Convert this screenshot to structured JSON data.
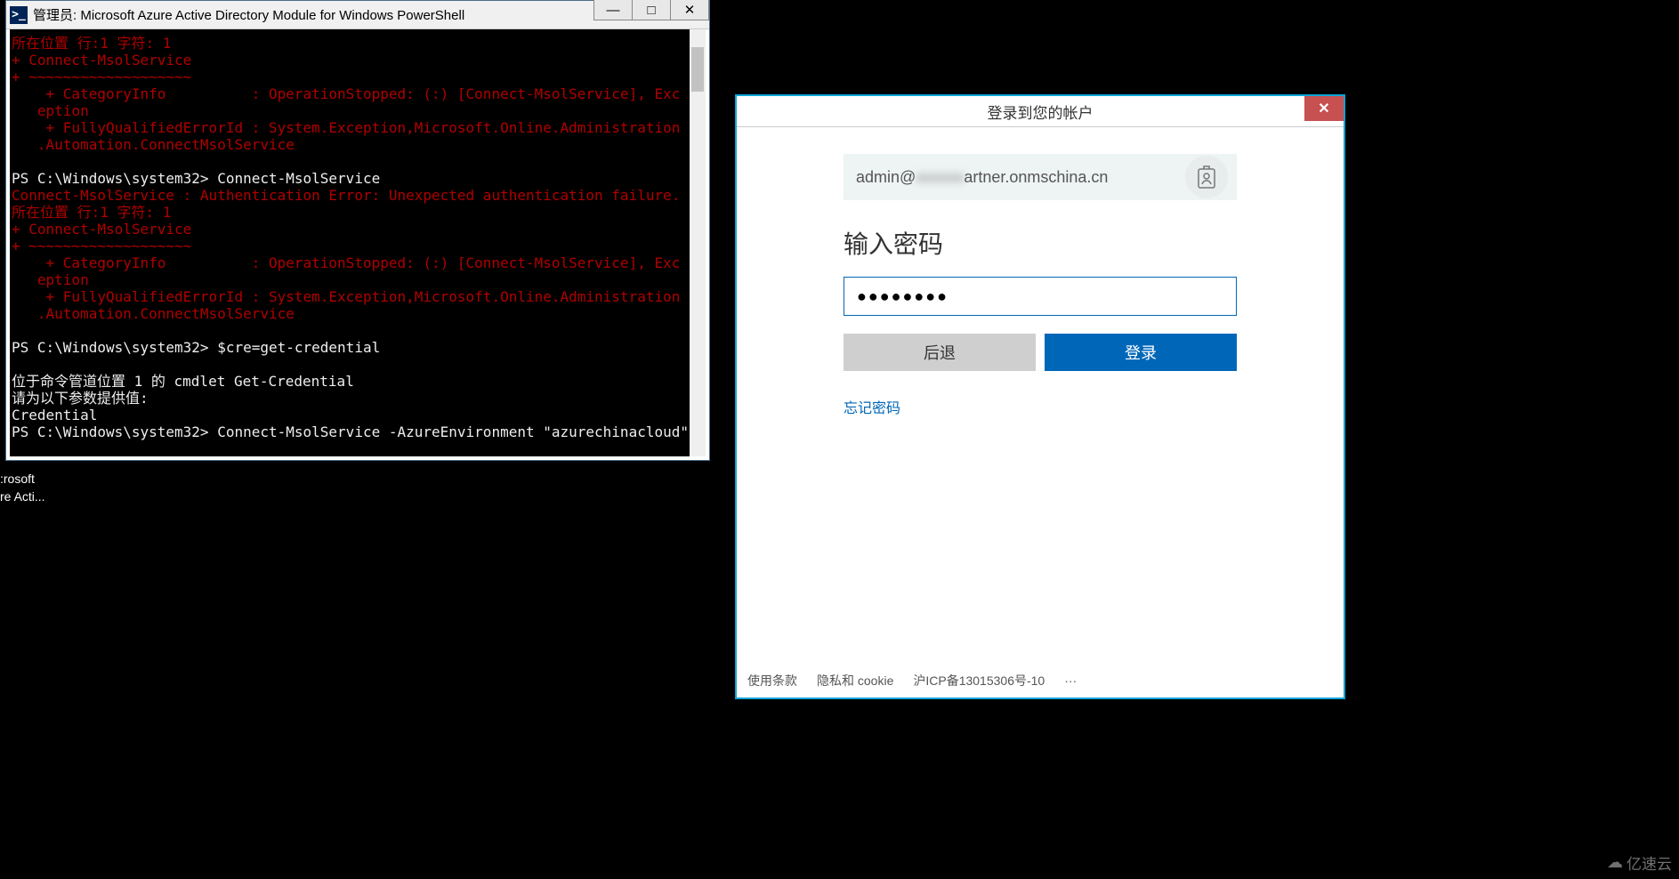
{
  "powershell": {
    "title": "管理员: Microsoft Azure Active Directory Module for Windows PowerShell",
    "icon_glyph": ">_",
    "lines": [
      {
        "cls": "red",
        "text": "所在位置 行:1 字符: 1"
      },
      {
        "cls": "red",
        "text": "+ Connect-MsolService"
      },
      {
        "cls": "red",
        "text": "+ ~~~~~~~~~~~~~~~~~~~"
      },
      {
        "cls": "red",
        "text": "    + CategoryInfo          : OperationStopped: (:) [Connect-MsolService], Exc"
      },
      {
        "cls": "red",
        "text": "   eption"
      },
      {
        "cls": "red",
        "text": "    + FullyQualifiedErrorId : System.Exception,Microsoft.Online.Administration"
      },
      {
        "cls": "red",
        "text": "   .Automation.ConnectMsolService"
      },
      {
        "cls": "white",
        "text": ""
      },
      {
        "cls": "white",
        "text": "PS C:\\Windows\\system32> Connect-MsolService"
      },
      {
        "cls": "red",
        "text": "Connect-MsolService : Authentication Error: Unexpected authentication failure."
      },
      {
        "cls": "red",
        "text": "所在位置 行:1 字符: 1"
      },
      {
        "cls": "red",
        "text": "+ Connect-MsolService"
      },
      {
        "cls": "red",
        "text": "+ ~~~~~~~~~~~~~~~~~~~"
      },
      {
        "cls": "red",
        "text": "    + CategoryInfo          : OperationStopped: (:) [Connect-MsolService], Exc"
      },
      {
        "cls": "red",
        "text": "   eption"
      },
      {
        "cls": "red",
        "text": "    + FullyQualifiedErrorId : System.Exception,Microsoft.Online.Administration"
      },
      {
        "cls": "red",
        "text": "   .Automation.ConnectMsolService"
      },
      {
        "cls": "white",
        "text": ""
      },
      {
        "cls": "white",
        "text": "PS C:\\Windows\\system32> $cre=get-credential"
      },
      {
        "cls": "white",
        "text": ""
      },
      {
        "cls": "white",
        "text": "位于命令管道位置 1 的 cmdlet Get-Credential"
      },
      {
        "cls": "white",
        "text": "请为以下参数提供值:"
      },
      {
        "cls": "white",
        "text": "Credential"
      },
      {
        "cls": "white",
        "text": "PS C:\\Windows\\system32> Connect-MsolService -AzureEnvironment \"azurechinacloud\""
      }
    ]
  },
  "taskfrag": {
    "line1": ":rosoft",
    "line2": "re Acti..."
  },
  "login": {
    "title": "登录到您的帐户",
    "email_prefix": "admin@",
    "email_blur": "xxxxxx",
    "email_suffix": "artner.onmschina.cn",
    "password_heading": "输入密码",
    "password_value": "●●●●●●●●",
    "back_label": "后退",
    "login_label": "登录",
    "forgot_label": "忘记密码",
    "footer": {
      "terms": "使用条款",
      "privacy": "隐私和 cookie",
      "icp": "沪ICP备13015306号-10",
      "more": "···"
    }
  },
  "watermark": "亿速云"
}
